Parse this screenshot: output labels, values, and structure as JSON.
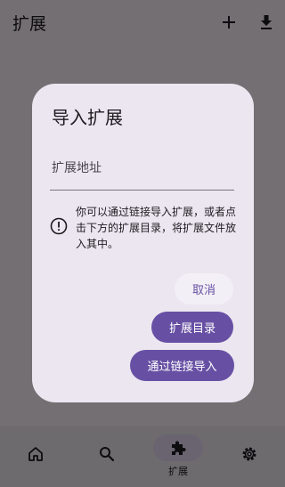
{
  "appbar": {
    "title": "扩展",
    "add_icon": "plus-icon",
    "download_icon": "download-icon"
  },
  "bottom_nav": {
    "items": [
      {
        "icon": "home-icon",
        "label": ""
      },
      {
        "icon": "search-icon",
        "label": ""
      },
      {
        "icon": "puzzle-icon",
        "label": "扩展"
      },
      {
        "icon": "gear-icon",
        "label": ""
      }
    ],
    "selected": 2
  },
  "dialog": {
    "title": "导入扩展",
    "field_placeholder": "扩展地址",
    "info_icon": "info-icon",
    "info_text": "你可以通过链接导入扩展，或者点击下方的扩展目录，将扩展文件放入其中。",
    "buttons": {
      "cancel": "取消",
      "catalog": "扩展目录",
      "import_link": "通过链接导入"
    }
  },
  "colors": {
    "primary": "#6750a4",
    "dialog_bg": "#ece6f0",
    "nav_bg": "#f3edf7",
    "selected_indicator": "#e8def8"
  }
}
